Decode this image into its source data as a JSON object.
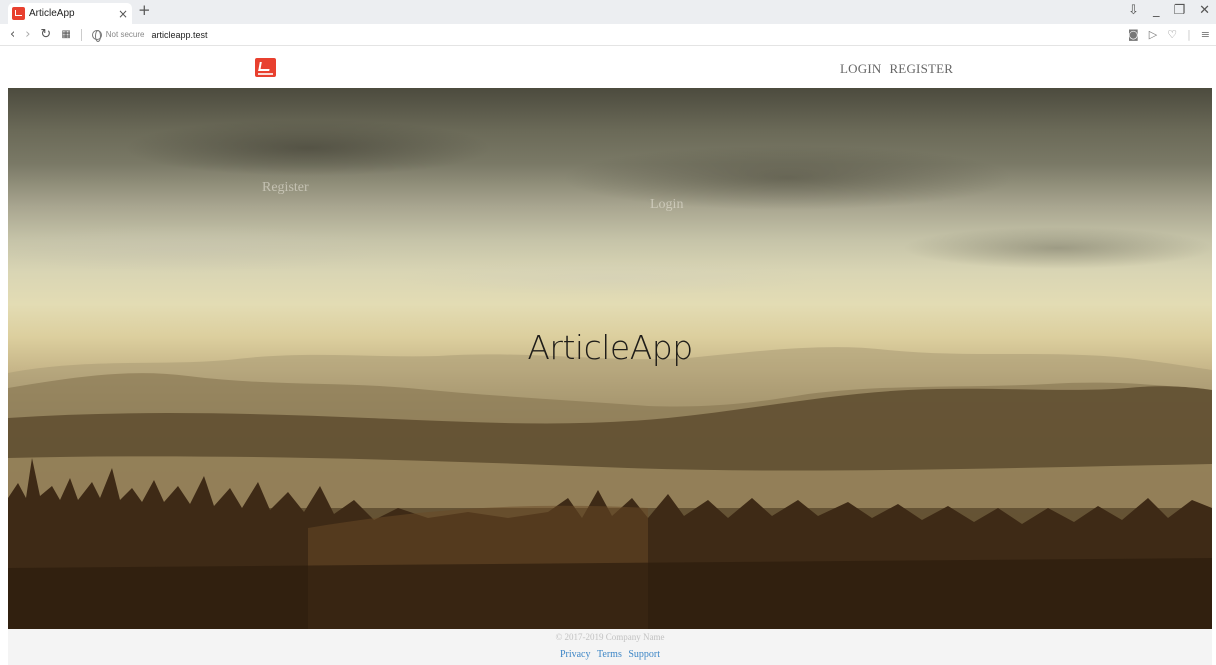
{
  "browser": {
    "tab_title": "ArticleApp",
    "tab_close": "×",
    "new_tab": "+",
    "not_secure": "Not secure",
    "url": "articleapp.test",
    "window_controls": {
      "minimize": "_",
      "restore": "❐",
      "close": "✕",
      "menu": "⇩"
    }
  },
  "navbar": {
    "login": "LOGIN",
    "register": "REGISTER"
  },
  "hero": {
    "register": "Register",
    "login": "Login",
    "title": "ArticleApp"
  },
  "footer": {
    "copyright": "© 2017-2019 Company Name",
    "links": [
      "Privacy",
      "Terms",
      "Support"
    ]
  },
  "colors": {
    "brand": "#e8402f",
    "link": "#3d86c6"
  }
}
